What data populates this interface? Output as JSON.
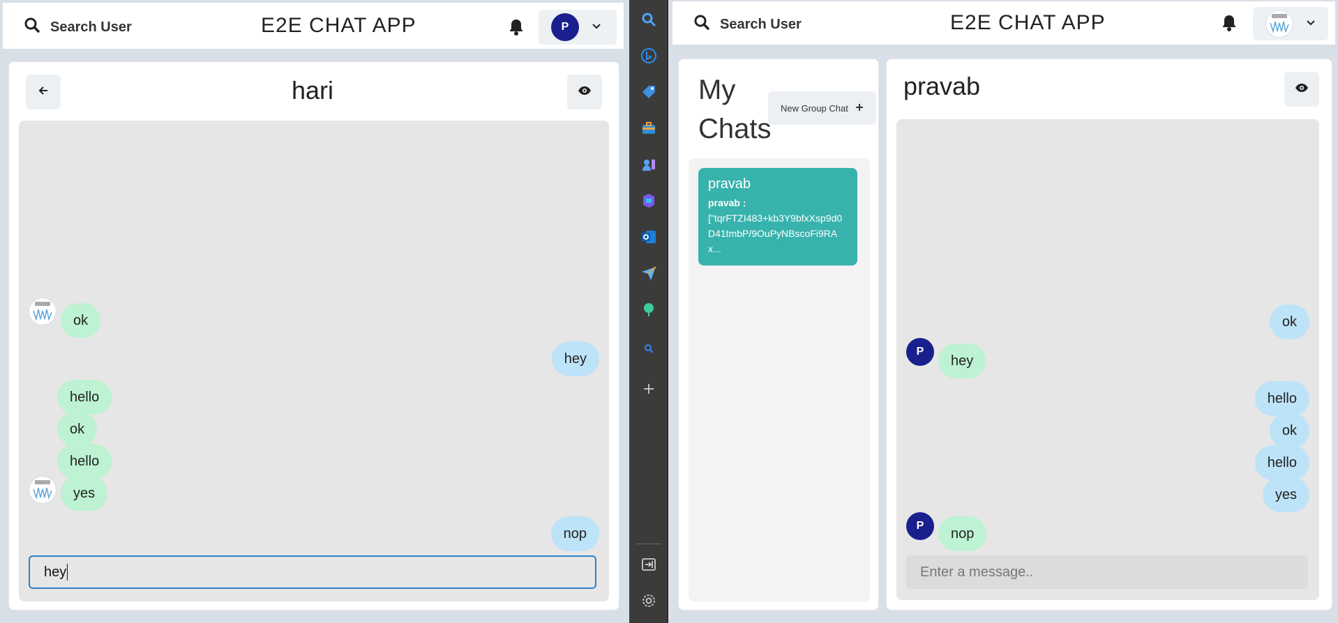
{
  "left_window": {
    "header": {
      "search_label": "Search User",
      "app_title": "E2E CHAT APP",
      "avatar_letter": "P"
    },
    "chat": {
      "title": "hari",
      "messages": [
        {
          "text": "ok",
          "side": "in",
          "avatar": "image"
        },
        {
          "text": "hey",
          "side": "out"
        },
        {
          "text": "hello",
          "side": "in"
        },
        {
          "text": "ok",
          "side": "in"
        },
        {
          "text": "hello",
          "side": "in"
        },
        {
          "text": "yes",
          "side": "in",
          "avatar": "image"
        },
        {
          "text": "nop",
          "side": "out"
        }
      ],
      "input_value": "hey"
    }
  },
  "sidebar": {
    "icons": [
      "search-icon",
      "bing-icon",
      "tag-icon",
      "briefcase-icon",
      "games-icon",
      "copilot-icon",
      "outlook-icon",
      "send-icon",
      "tree-icon",
      "search-small-icon",
      "add-icon",
      "exit-icon",
      "settings-icon"
    ],
    "colors": {
      "background": "#3b3b3b"
    }
  },
  "right_window": {
    "header": {
      "search_label": "Search User",
      "app_title": "E2E CHAT APP"
    },
    "my_chats": {
      "title": "My Chats",
      "new_group_label": "New Group Chat",
      "items": [
        {
          "name": "pravab",
          "preview_sender": "pravab :",
          "preview_text": "[\"tqrFTZI483+kb3Y9bfxXsp9d0D41tmbP/9OuPyNBscoFi9RAx..."
        }
      ]
    },
    "chat": {
      "title": "pravab",
      "avatar_letter": "P",
      "messages": [
        {
          "text": "ok",
          "side": "out"
        },
        {
          "text": "hey",
          "side": "in",
          "avatar": "P"
        },
        {
          "text": "hello",
          "side": "out"
        },
        {
          "text": "ok",
          "side": "out"
        },
        {
          "text": "hello",
          "side": "out"
        },
        {
          "text": "yes",
          "side": "out"
        },
        {
          "text": "nop",
          "side": "in",
          "avatar": "P"
        }
      ],
      "input_placeholder": "Enter a message.."
    }
  },
  "colors": {
    "incoming_bubble": "#bdf2d2",
    "outgoing_bubble": "#bde3f8",
    "chat_item": "#38b2ac",
    "avatar": "#1a1f8e"
  }
}
